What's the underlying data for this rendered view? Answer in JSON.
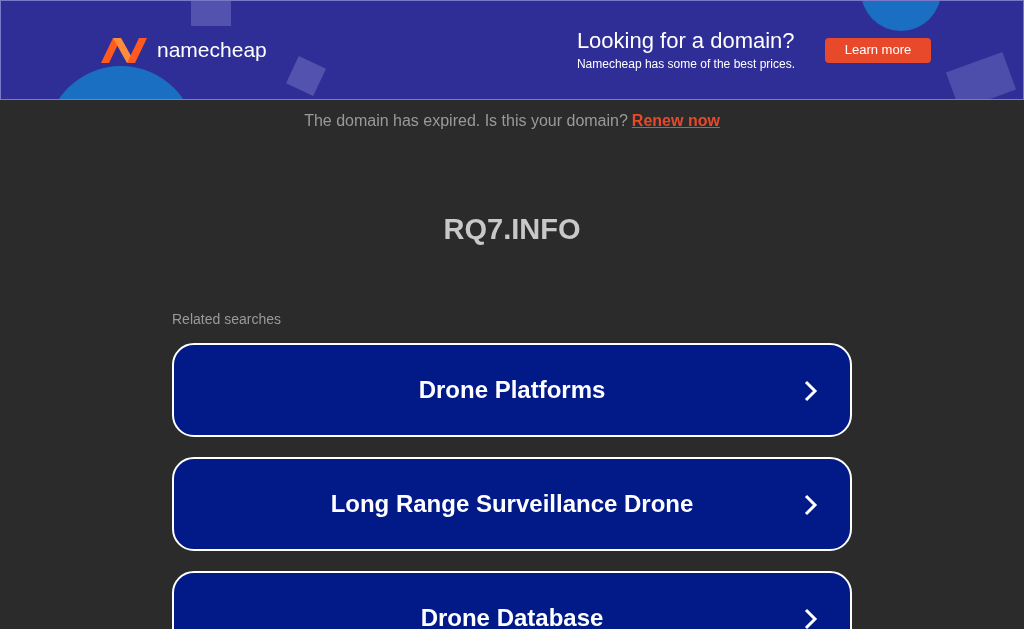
{
  "banner": {
    "brand": "namecheap",
    "headline": "Looking for a domain?",
    "subline": "Namecheap has some of the best prices.",
    "button": "Learn more"
  },
  "notice": {
    "text": "The domain has expired. Is this your domain?",
    "link": "Renew now"
  },
  "domain_title": "RQ7.INFO",
  "related": {
    "heading": "Related searches",
    "items": [
      {
        "label": "Drone Platforms"
      },
      {
        "label": "Long Range Surveillance Drone"
      },
      {
        "label": "Drone Database"
      }
    ]
  }
}
